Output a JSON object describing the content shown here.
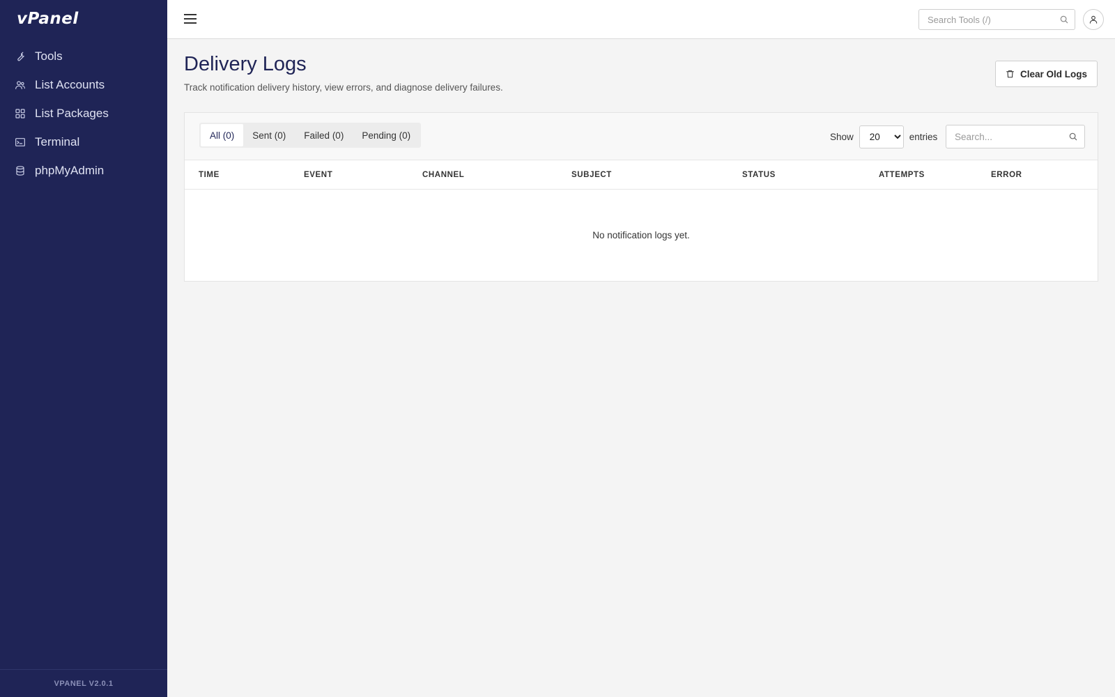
{
  "app": {
    "logo": "vPanel",
    "version": "VPANEL V2.0.1"
  },
  "sidebar": {
    "items": [
      {
        "label": "Tools",
        "icon": "wrench-icon"
      },
      {
        "label": "List Accounts",
        "icon": "users-icon"
      },
      {
        "label": "List Packages",
        "icon": "grid-icon"
      },
      {
        "label": "Terminal",
        "icon": "terminal-icon"
      },
      {
        "label": "phpMyAdmin",
        "icon": "database-icon"
      }
    ]
  },
  "topbar": {
    "search_placeholder": "Search Tools (/)"
  },
  "page": {
    "title": "Delivery Logs",
    "subtitle": "Track notification delivery history, view errors, and diagnose delivery failures.",
    "clear_button": "Clear Old Logs"
  },
  "tabs": [
    {
      "label": "All (0)",
      "active": true
    },
    {
      "label": "Sent (0)",
      "active": false
    },
    {
      "label": "Failed (0)",
      "active": false
    },
    {
      "label": "Pending (0)",
      "active": false
    }
  ],
  "entries": {
    "show_label": "Show",
    "selected": "20",
    "options": [
      "10",
      "20",
      "50",
      "100"
    ],
    "suffix_label": "entries",
    "search_placeholder": "Search..."
  },
  "table": {
    "columns": [
      "TIME",
      "EVENT",
      "CHANNEL",
      "SUBJECT",
      "STATUS",
      "ATTEMPTS",
      "ERROR"
    ],
    "rows": [],
    "empty_message": "No notification logs yet."
  }
}
